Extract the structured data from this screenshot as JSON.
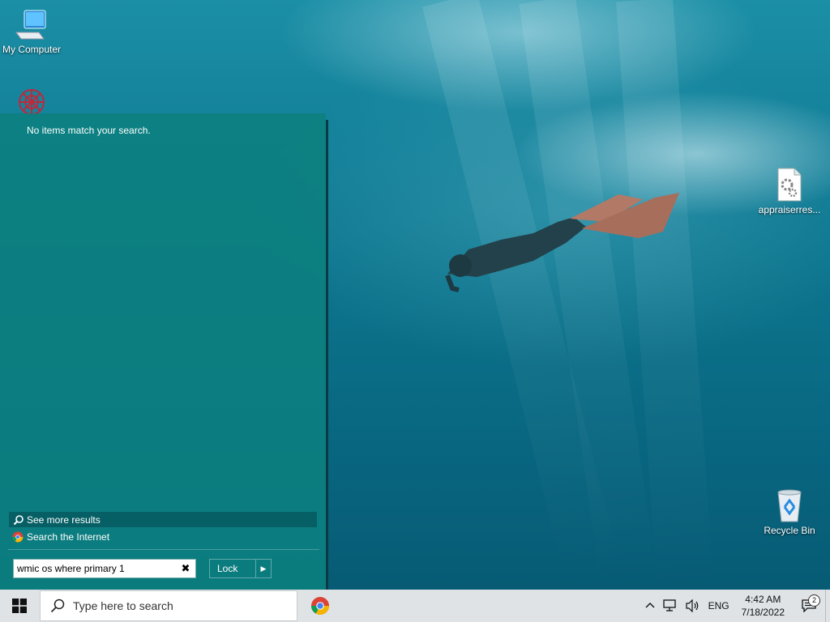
{
  "desktop": {
    "icons": [
      {
        "label": "My Computer",
        "icon": "computer-icon"
      },
      {
        "label": "",
        "icon": "red-network-icon"
      },
      {
        "label": "appraiserres...",
        "icon": "settings-file-icon"
      },
      {
        "label": "Recycle Bin",
        "icon": "recycle-bin-icon"
      }
    ]
  },
  "start_panel": {
    "no_items_text": "No items match your search.",
    "see_more_label": "See more results",
    "search_internet_label": "Search the Internet",
    "search_value": "wmic os where primary 1",
    "lock_label": "Lock"
  },
  "taskbar": {
    "search_placeholder": "Type here to search",
    "pinned": [
      {
        "icon": "chrome-icon"
      }
    ],
    "tray": {
      "language": "ENG",
      "time": "4:42 AM",
      "date": "7/18/2022",
      "notification_count": "2"
    }
  },
  "colors": {
    "panel": "#0c8080",
    "taskbar": "#dfe3e6",
    "wallpaper": "#0b7089"
  }
}
